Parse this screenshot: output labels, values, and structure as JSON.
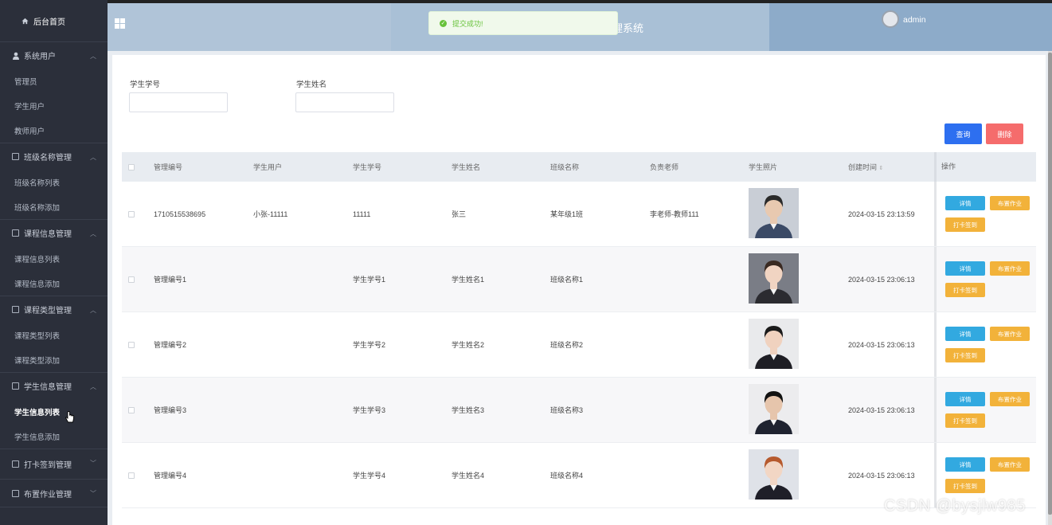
{
  "sidebar": {
    "home_label": "后台首页",
    "groups": [
      {
        "label": "系统用户",
        "items": [
          "管理员",
          "学生用户",
          "教师用户"
        ]
      },
      {
        "label": "班级名称管理",
        "items": [
          "班级名称列表",
          "班级名称添加"
        ]
      },
      {
        "label": "课程信息管理",
        "items": [
          "课程信息列表",
          "课程信息添加"
        ]
      },
      {
        "label": "课程类型管理",
        "items": [
          "课程类型列表",
          "课程类型添加"
        ]
      },
      {
        "label": "学生信息管理",
        "items": [
          "学生信息列表",
          "学生信息添加"
        ]
      },
      {
        "label": "打卡签到管理",
        "items": []
      },
      {
        "label": "布置作业管理",
        "items": []
      }
    ],
    "active_item": "学生信息列表"
  },
  "header": {
    "title_fragment": "理系统",
    "username": "admin"
  },
  "toast": {
    "message": "提交成功!"
  },
  "search": {
    "student_no_label": "学生学号",
    "student_name_label": "学生姓名",
    "query_button": "查询",
    "delete_button": "删除"
  },
  "table": {
    "headers": [
      "管理编号",
      "学生用户",
      "学生学号",
      "学生姓名",
      "班级名称",
      "负责老师",
      "学生照片",
      "创建时间",
      "操作"
    ],
    "rows": [
      {
        "id": "1710515538695",
        "user": "小张-11111",
        "no": "11111",
        "name": "张三",
        "class": "某年级1班",
        "teacher": "李老师-教师111",
        "time": "2024-03-15 23:13:59"
      },
      {
        "id": "管理编号1",
        "user": "",
        "no": "学生学号1",
        "name": "学生姓名1",
        "class": "班级名称1",
        "teacher": "",
        "time": "2024-03-15 23:06:13"
      },
      {
        "id": "管理编号2",
        "user": "",
        "no": "学生学号2",
        "name": "学生姓名2",
        "class": "班级名称2",
        "teacher": "",
        "time": "2024-03-15 23:06:13"
      },
      {
        "id": "管理编号3",
        "user": "",
        "no": "学生学号3",
        "name": "学生姓名3",
        "class": "班级名称3",
        "teacher": "",
        "time": "2024-03-15 23:06:13"
      },
      {
        "id": "管理编号4",
        "user": "",
        "no": "学生学号4",
        "name": "学生姓名4",
        "class": "班级名称4",
        "teacher": "",
        "time": "2024-03-15 23:06:13"
      }
    ],
    "op_detail": "详情",
    "op_assign": "布置作业",
    "op_punch": "打卡签到"
  },
  "watermark": "CSDN @bysjlw985"
}
